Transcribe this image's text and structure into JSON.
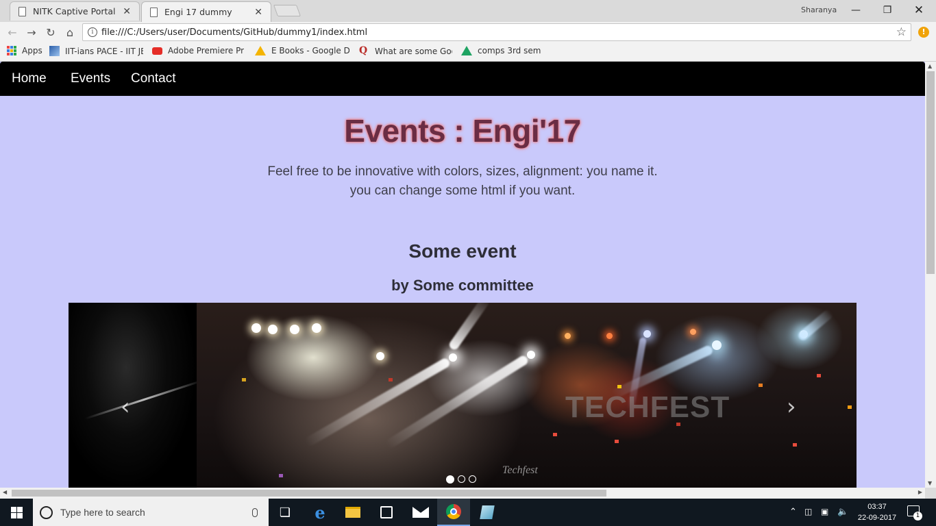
{
  "browser": {
    "tabs": [
      {
        "title": "NITK Captive Portal",
        "active": false
      },
      {
        "title": "Engi 17 dummy",
        "active": true
      }
    ],
    "profile_name": "Sharanya",
    "url": "file:///C:/Users/user/Documents/GitHub/dummy1/index.html",
    "bookmarks": [
      {
        "label": "Apps",
        "icon": "apps-grid-icon"
      },
      {
        "label": "IIT-ians PACE - IIT JEE",
        "icon": "pace-logo-icon"
      },
      {
        "label": "Adobe Premiere Pro I",
        "icon": "youtube-icon"
      },
      {
        "label": "E Books - Google Driv",
        "icon": "google-drive-icon"
      },
      {
        "label": "What are some Goog",
        "icon": "quora-icon"
      },
      {
        "label": "comps 3rd sem",
        "icon": "google-drive-icon"
      }
    ],
    "accent_alert_color": "#f0a30a"
  },
  "site": {
    "nav": [
      "Home",
      "Events",
      "Contact"
    ],
    "title": "Events : Engi'17",
    "subtitle_line1": "Feel free to be innovative with colors, sizes, alignment: you name it.",
    "subtitle_line2": "you can change some html if you want.",
    "event_name": "Some event",
    "event_by": "by Some committee",
    "carousel": {
      "prev_symbol": "‹",
      "next_symbol": "›",
      "slide_count": 3,
      "active_index": 0,
      "image_text": "TECHFEST",
      "image_subtext": "Techfest"
    },
    "colors": {
      "page_bg": "#c9c9fb",
      "nav_bg": "#000000",
      "title_color": "#6a2d44",
      "title_glow": "#ff8a8a"
    }
  },
  "taskbar": {
    "search_placeholder": "Type here to search",
    "pinned": [
      "task-view-icon",
      "edge-icon",
      "file-explorer-icon",
      "store-icon",
      "mail-icon",
      "chrome-icon",
      "app-icon"
    ],
    "time": "03:37",
    "date": "22-09-2017",
    "notification_count": "1"
  }
}
